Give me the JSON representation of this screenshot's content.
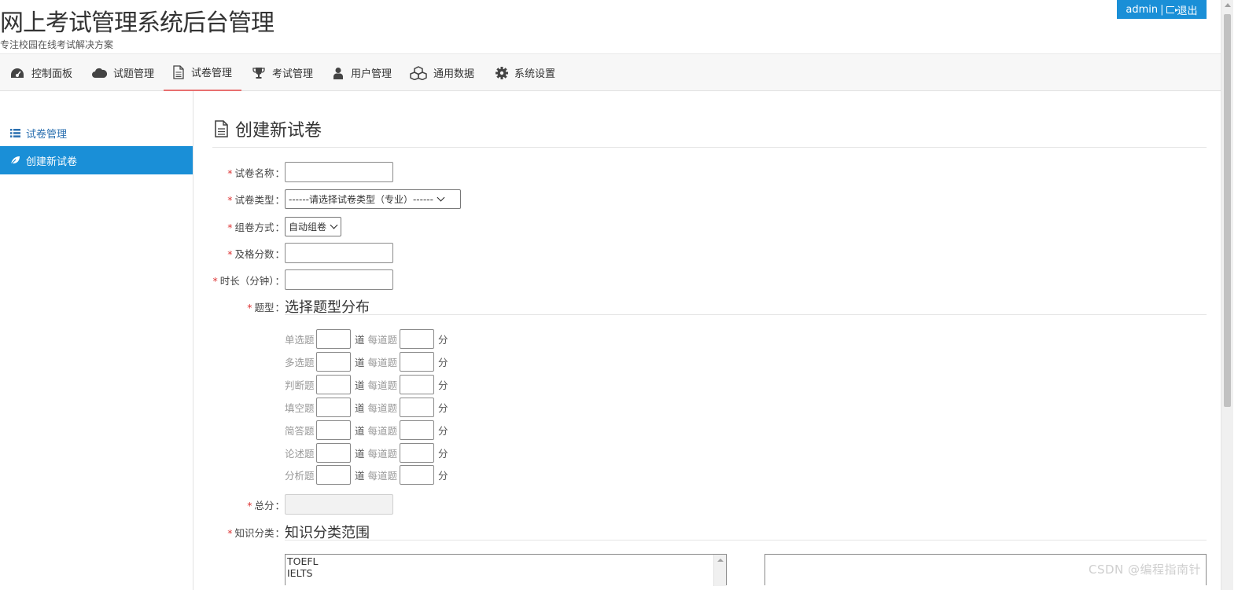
{
  "header": {
    "title": "网上考试管理系统后台管理",
    "subtitle": "专注校园在线考试解决方案",
    "user": "admin",
    "separator": "|",
    "logout_label": "退出"
  },
  "nav": {
    "items": [
      {
        "label": "控制面板",
        "icon": "dashboard-icon"
      },
      {
        "label": "试题管理",
        "icon": "cloud-icon"
      },
      {
        "label": "试卷管理",
        "icon": "document-icon",
        "active": true
      },
      {
        "label": "考试管理",
        "icon": "trophy-icon"
      },
      {
        "label": "用户管理",
        "icon": "user-icon"
      },
      {
        "label": "通用数据",
        "icon": "cubes-icon"
      },
      {
        "label": "系统设置",
        "icon": "gear-icon"
      }
    ],
    "active_color": "#e87070"
  },
  "sidebar": {
    "items": [
      {
        "label": "试卷管理",
        "icon": "list-icon"
      },
      {
        "label": "创建新试卷",
        "icon": "leaf-icon",
        "active": true
      }
    ],
    "active_bg": "#1a8fd7"
  },
  "main": {
    "heading": "创建新试卷",
    "fields": {
      "name_label": "试卷名称",
      "type_label": "试卷类型",
      "type_value": "------请选择试卷类型（专业）------",
      "mode_label": "组卷方式",
      "mode_value": "自动组卷",
      "pass_label": "及格分数",
      "duration_label": "时长（分钟）",
      "qtype_label": "题型",
      "qtype_section": "选择题型分布",
      "total_label": "总分",
      "knowledge_label": "知识分类",
      "knowledge_section": "知识分类范围",
      "required_mark": "*",
      "colon": "："
    },
    "question_types": [
      {
        "name": "单选题"
      },
      {
        "name": "多选题"
      },
      {
        "name": "判断题"
      },
      {
        "name": "填空题"
      },
      {
        "name": "简答题"
      },
      {
        "name": "论述题"
      },
      {
        "name": "分析题"
      }
    ],
    "count_unit": "道",
    "per_label": "每道题",
    "score_unit": "分",
    "knowledge_options": [
      "TOEFL",
      "IELTS"
    ]
  },
  "watermark": "CSDN @编程指南针"
}
